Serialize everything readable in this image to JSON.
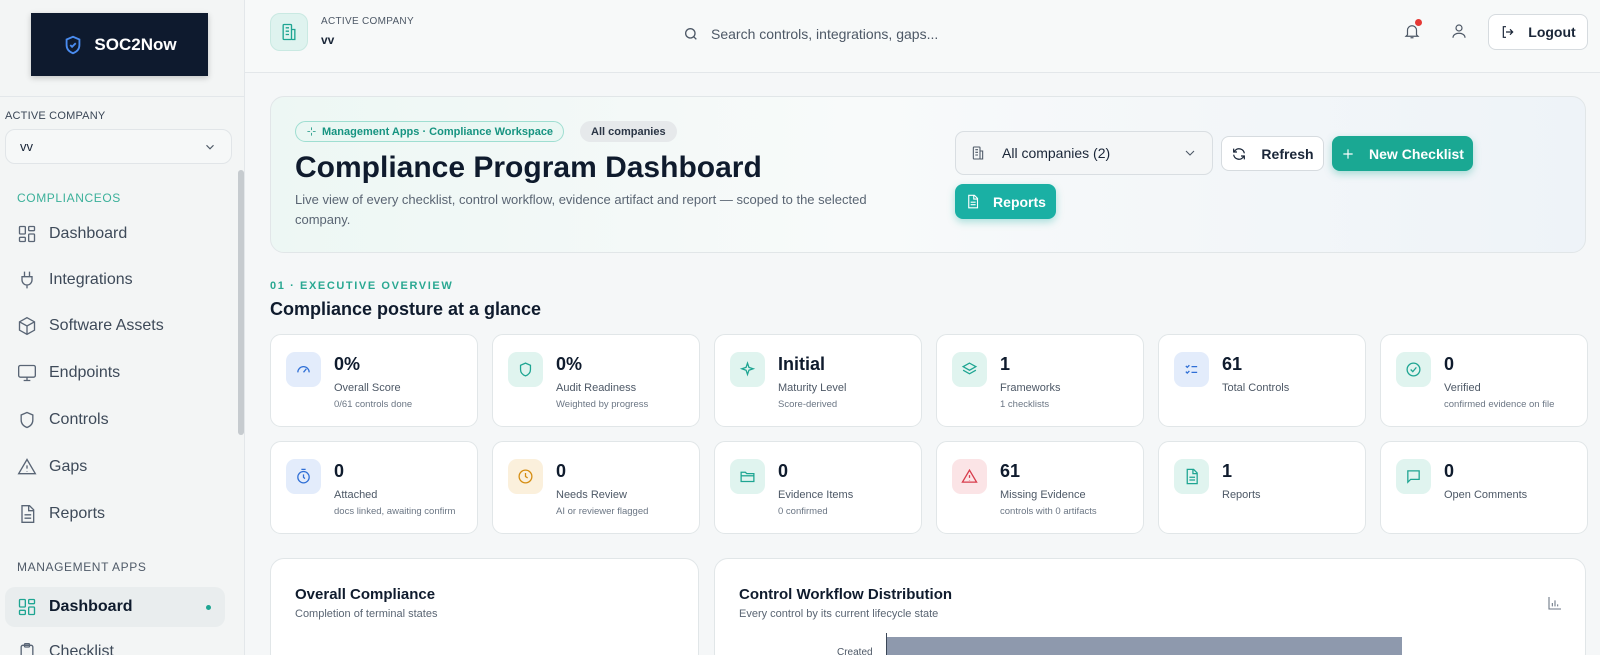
{
  "brand": {
    "name": "SOC2Now"
  },
  "sidebar": {
    "active_company_label": "ACTIVE COMPANY",
    "company_value": "vv",
    "section_complianceos": "COMPLIANCEOS",
    "items": [
      {
        "label": "Dashboard",
        "icon": "grid-icon"
      },
      {
        "label": "Integrations",
        "icon": "plug-icon"
      },
      {
        "label": "Software Assets",
        "icon": "box-icon"
      },
      {
        "label": "Endpoints",
        "icon": "monitor-icon"
      },
      {
        "label": "Controls",
        "icon": "shield-icon"
      },
      {
        "label": "Gaps",
        "icon": "warning-icon"
      },
      {
        "label": "Reports",
        "icon": "document-icon"
      }
    ],
    "section_management": "MANAGEMENT APPS",
    "mgmt_items": [
      {
        "label": "Dashboard",
        "icon": "grid-icon",
        "active": true
      },
      {
        "label": "Checklist",
        "icon": "clipboard-icon"
      }
    ]
  },
  "header": {
    "active_company_label": "ACTIVE COMPANY",
    "company": "vv",
    "search_placeholder": "Search controls, integrations, gaps...",
    "logout": "Logout"
  },
  "hero": {
    "tag": "Management Apps · Compliance Workspace",
    "tag2": "All companies",
    "title": "Compliance Program Dashboard",
    "subtitle": "Live view of every checklist, control workflow, evidence artifact and report — scoped to the selected company.",
    "company_select": "All companies (2)",
    "refresh": "Refresh",
    "new_checklist": "New Checklist",
    "reports": "Reports"
  },
  "overview": {
    "label": "01 · EXECUTIVE OVERVIEW",
    "title": "Compliance posture at a glance",
    "cards": [
      {
        "value": "0%",
        "label": "Overall Score",
        "sub": "0/61 controls done",
        "icon": "gauge-icon",
        "tone": "blue"
      },
      {
        "value": "0%",
        "label": "Audit Readiness",
        "sub": "Weighted by progress",
        "icon": "shield-icon",
        "tone": "teal"
      },
      {
        "value": "Initial",
        "label": "Maturity Level",
        "sub": "Score-derived",
        "icon": "sparkle-icon",
        "tone": "teal"
      },
      {
        "value": "1",
        "label": "Frameworks",
        "sub": "1 checklists",
        "icon": "layers-icon",
        "tone": "teal"
      },
      {
        "value": "61",
        "label": "Total Controls",
        "sub": "",
        "icon": "list-check-icon",
        "tone": "blue"
      },
      {
        "value": "0",
        "label": "Verified",
        "sub": "confirmed evidence on file",
        "icon": "check-circle-icon",
        "tone": "teal"
      },
      {
        "value": "0",
        "label": "Attached",
        "sub": "docs linked, awaiting confirm",
        "icon": "timer-icon",
        "tone": "blue"
      },
      {
        "value": "0",
        "label": "Needs Review",
        "sub": "AI or reviewer flagged",
        "icon": "clock-icon",
        "tone": "amber"
      },
      {
        "value": "0",
        "label": "Evidence Items",
        "sub": "0 confirmed",
        "icon": "folder-icon",
        "tone": "teal"
      },
      {
        "value": "61",
        "label": "Missing Evidence",
        "sub": "controls with 0 artifacts",
        "icon": "warning-icon",
        "tone": "red"
      },
      {
        "value": "1",
        "label": "Reports",
        "sub": "",
        "icon": "document-icon",
        "tone": "teal"
      },
      {
        "value": "0",
        "label": "Open Comments",
        "sub": "",
        "icon": "comment-icon",
        "tone": "teal"
      }
    ]
  },
  "panels": {
    "compliance": {
      "title": "Overall Compliance",
      "subtitle": "Completion of terminal states"
    },
    "workflow": {
      "title": "Control Workflow Distribution",
      "subtitle": "Every control by its current lifecycle state",
      "first_label": "Created"
    }
  },
  "chart_data": {
    "type": "bar",
    "categories": [
      "Created"
    ],
    "values": [
      61
    ],
    "title": "Control Workflow Distribution",
    "xlabel": "",
    "ylabel": ""
  }
}
